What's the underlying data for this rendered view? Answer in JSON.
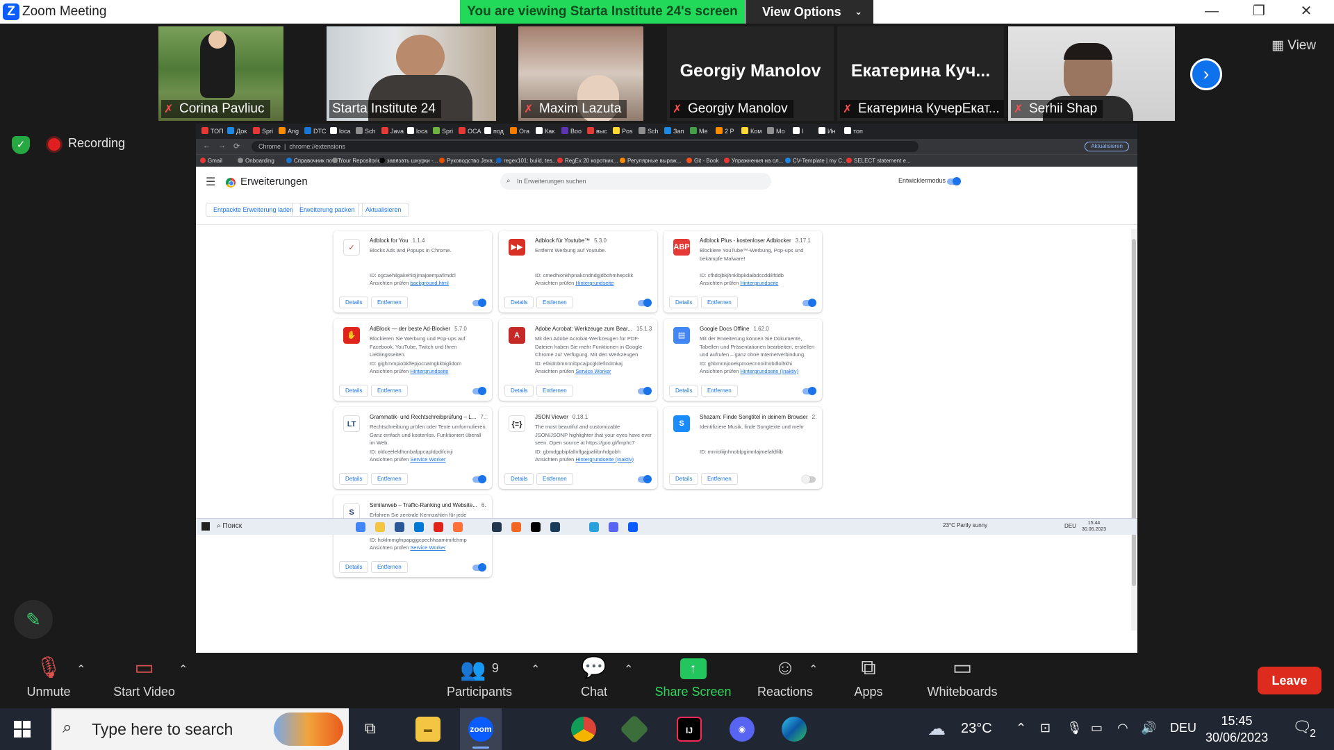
{
  "window": {
    "app_logo": "Z",
    "title": "Zoom Meeting",
    "viewing_banner": "You are viewing Starta Institute 24's screen",
    "view_options": "View Options",
    "controls": [
      "—",
      "❐",
      "✕"
    ]
  },
  "gallery": {
    "view_label": "View",
    "tiles": [
      {
        "name": "Corina Pavliuc",
        "muted": true,
        "has_video": true
      },
      {
        "name": "Starta Institute 24",
        "muted": false,
        "has_video": true,
        "active": true
      },
      {
        "name": "Maxim Lazuta",
        "muted": true,
        "has_video": true
      },
      {
        "name": "Georgiy Manolov",
        "big": "Georgiy Manolov",
        "muted": true,
        "has_video": false
      },
      {
        "name": "Екатерина КучерЕкат...",
        "big": "Екатерина  Куч...",
        "muted": true,
        "has_video": false
      },
      {
        "name": "Serhii Shap",
        "muted": true,
        "has_video": true
      }
    ]
  },
  "status": {
    "recording": "Recording"
  },
  "chrome": {
    "tabs": [
      "ТОП",
      "Док",
      "Spri",
      "Ang",
      "DTC",
      "loca",
      "Sch",
      "Java",
      "loca",
      "Spri",
      "OCA",
      "под",
      "Ora",
      "Как",
      "Boo",
      "выс",
      "Pos",
      "Sch",
      "Зап",
      "Ме",
      "2 Р",
      "Ком",
      "Мо",
      "I",
      "Ин",
      "топ"
    ],
    "address_prefix": "Chrome",
    "address": "chrome://extensions",
    "update_label": "Aktualisieren",
    "bookmarks": [
      "Gmail",
      "Onboarding",
      "Справочник по HT...",
      "Your Repositories",
      "завязать шнурки -...",
      "Руководство Java...",
      "regex101: build, tes...",
      "RegEx 20 коротких...",
      "Регулярные выраж...",
      "Git - Book",
      "Упражнения на ол...",
      "CV-Template | my C...",
      "SELECT statement e..."
    ]
  },
  "extensions_page": {
    "title": "Erweiterungen",
    "search_placeholder": "In Erweiterungen suchen",
    "dev_mode": "Entwicklermodus",
    "buttons": [
      "Entpackte Erweiterung laden",
      "Erweiterung packen",
      "Aktualisieren"
    ],
    "details_label": "Details",
    "remove_label": "Entfernen",
    "view_prefix": "Ansichten prüfen",
    "cards": [
      {
        "name": "Adblock for You",
        "version": "1.1.4",
        "desc": "Blocks Ads and Popups in Chrome.",
        "id": "ID: ogcaehilgakehlojjmajoempafimdcl",
        "view": "background.html",
        "icon": "✓",
        "color": "#ffffff",
        "fg": "#c0392b",
        "enabled": true
      },
      {
        "name": "Adblock für Youtube™",
        "version": "5.3.0",
        "desc": "Entfernt Werbung auf Youtube.",
        "id": "ID: cmedhionkhpnakcndndgjdbohmhepckk",
        "view": "Hintergrundseite",
        "icon": "▶▶",
        "color": "#d93025",
        "fg": "#ffffff",
        "enabled": true
      },
      {
        "name": "Adblock Plus - kostenloser Adblocker",
        "version": "3.17.1",
        "desc": "Blockiere YouTube™-Werbung, Pop-ups und bekämpfe Malware!",
        "id": "ID: cfhdojbkjhnklbpkdaibdccddilifddb",
        "view": "Hintergrundseite",
        "icon": "ABP",
        "color": "#e53935",
        "fg": "#ffffff",
        "enabled": true
      },
      {
        "name": "AdBlock — der beste Ad-Blocker",
        "version": "5.7.0",
        "desc": "Blockieren Sie Werbung und Pop-ups auf Facebook, YouTube, Twitch und Ihren Lieblingsseiten.",
        "id": "ID: gighmmpiobklfepjocnamgkkbiglidom",
        "view": "Hintergrundseite",
        "icon": "✋",
        "color": "#e0241b",
        "fg": "#ffffff",
        "enabled": true
      },
      {
        "name": "Adobe Acrobat: Werkzeuge zum Bear...",
        "version": "15.1.3.50",
        "desc": "Mit den Adobe Acrobat-Werkzeugen für PDF-Dateien haben Sie mehr Funktionen in Google Chrome zur Verfügung. Mit den Werkzeugen",
        "id": "ID: efaidnbmnnnibpcajpcglclefindmkaj",
        "view": "Service Worker",
        "icon": "A",
        "color": "#c62828",
        "fg": "#ffffff",
        "enabled": true
      },
      {
        "name": "Google Docs Offline",
        "version": "1.62.0",
        "desc": "Mit der Erweiterung können Sie Dokumente, Tabellen und Präsentationen bearbeiten, erstellen und aufrufen – ganz ohne Internetverbindung.",
        "id": "ID: ghbmnnjooekpmoecnnnilnnbdlolhkhi",
        "view": "Hintergrundseite (Inaktiv)",
        "icon": "▤",
        "color": "#4285f4",
        "fg": "#ffffff",
        "enabled": true
      },
      {
        "name": "Grammatik- und Rechtschreibprüfung – L...",
        "version": "7.1.8",
        "desc": "Rechtschreibung prüfen oder Texte umformulieren. Ganz einfach und kostenlos. Funktioniert überall im Web.",
        "id": "ID: oldceeleldhonbafppcapldpdifcinji",
        "view": "Service Worker",
        "icon": "LT",
        "color": "#ffffff",
        "fg": "#2b4a6f",
        "enabled": true
      },
      {
        "name": "JSON Viewer",
        "version": "0.18.1",
        "desc": "The most beautiful and customizable JSON/JSONP highlighter that your eyes have ever seen. Open source at https://goo.gl/fmphc7",
        "id": "ID: gbmdgpbipfallnflgajpaliibnhdgobh",
        "view": "Hintergrundseite (Inaktiv)",
        "icon": "{≡}",
        "color": "#ffffff",
        "fg": "#222222",
        "enabled": true
      },
      {
        "name": "Shazam: Finde Songtitel in deinem Browser",
        "version": "2.0.2",
        "desc": "Identifiziere Musik, finde Songtexte und mehr",
        "id": "ID: mmioliijnhnoblpgimnlajmefafdfilb",
        "view": "",
        "icon": "S",
        "color": "#1a8cff",
        "fg": "#ffffff",
        "enabled": false
      },
      {
        "name": "Similarweb – Traffic-Ranking und Website...",
        "version": "6.5.0",
        "desc": "Erfahren Sie zentrale Kennzahlen für jede Website, einschließlich des Traffic und Schlüsselwörter-Rankings und der Traffic-Quelle.",
        "id": "ID: hoklmmgfnpapgjgcpechhaamimifchmp",
        "view": "Service Worker",
        "icon": "S",
        "color": "#ffffff",
        "fg": "#2c3e77",
        "enabled": true
      }
    ]
  },
  "remote_taskbar": {
    "search": "Поиск",
    "weather": "23°C  Partly sunny",
    "lang": "DEU",
    "time": "15:44",
    "date": "30.06.2023"
  },
  "zoom_controls": {
    "unmute": "Unmute",
    "start_video": "Start Video",
    "participants": "Participants",
    "participants_count": "9",
    "chat": "Chat",
    "share_screen": "Share Screen",
    "reactions": "Reactions",
    "apps": "Apps",
    "whiteboards": "Whiteboards",
    "leave": "Leave"
  },
  "taskbar": {
    "search_placeholder": "Type here to search",
    "zoom_label": "zoom",
    "temperature": "23°C",
    "language": "DEU",
    "time": "15:45",
    "date": "30/06/2023",
    "notifications": "2"
  }
}
